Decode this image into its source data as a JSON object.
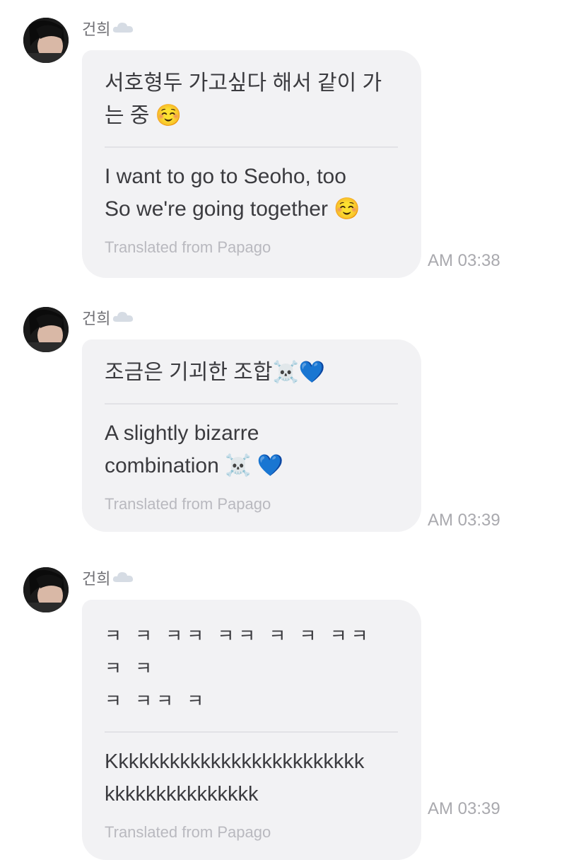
{
  "messages": [
    {
      "sender": "건희",
      "original": "서호형두 가고싶다 해서 같이 가는 중 ☺️",
      "original_line1": "서호형두 가고싶다 해서 같이 가",
      "original_line2": "는 중 ☺️",
      "translated_line1": "I want to go to Seoho, too",
      "translated_line2": "So we're going together ☺️",
      "credit": "Translated from Papago",
      "time": "AM 03:38"
    },
    {
      "sender": "건희",
      "original_line1": "조금은 기괴한 조합☠️💙",
      "translated_line1": "A slightly bizarre",
      "translated_line2": "combination ☠️ 💙",
      "credit": "Translated from Papago",
      "time": "AM 03:39"
    },
    {
      "sender": "건희",
      "original_line1": "ㅋ ㅋ ㅋㅋ ㅋㅋ ㅋ ㅋ ㅋㅋ ㅋ ㅋ",
      "original_line2": "ㅋ ㅋㅋ ㅋ",
      "translated_line1": "Kkkkkkkkkkkkkkkkkkkkkkkkk",
      "translated_line2": "kkkkkkkkkkkkkkk",
      "credit": "Translated from Papago",
      "time": "AM 03:39"
    }
  ],
  "icons": {
    "sender_suffix": "cloud-icon"
  }
}
